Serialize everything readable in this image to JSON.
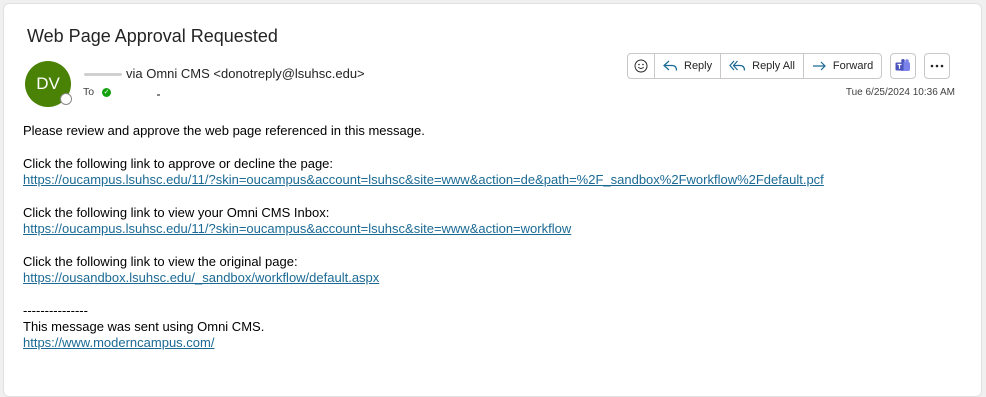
{
  "email": {
    "subject": "Web Page Approval Requested",
    "avatar_initials": "DV",
    "sender": "via Omni CMS <donotreply@lsuhsc.edu>",
    "to_label": "To",
    "date": "Tue 6/25/2024 10:36 AM"
  },
  "actions": {
    "reply": "Reply",
    "reply_all": "Reply All",
    "forward": "Forward"
  },
  "body": {
    "intro": "Please review and approve the web page referenced in this message.",
    "approve_text": "Click the following link to approve or decline the page:",
    "approve_link": "https://oucampus.lsuhsc.edu/11/?skin=oucampus&account=lsuhsc&site=www&action=de&path=%2F_sandbox%2Fworkflow%2Fdefault.pcf",
    "inbox_text": "Click the following link to view your Omni CMS Inbox:",
    "inbox_link": "https://oucampus.lsuhsc.edu/11/?skin=oucampus&account=lsuhsc&site=www&action=workflow",
    "original_text": "Click the following link to view the original page:",
    "original_link": "https://ousandbox.lsuhsc.edu/_sandbox/workflow/default.aspx",
    "separator": "---------------",
    "footer_text": "This message was sent using Omni CMS.",
    "footer_link": "https://www.moderncampus.com/"
  },
  "colors": {
    "avatar": "#498205",
    "link": "#1b6a95",
    "teams": "#4b53bc",
    "reply_icon": "#1b6a95"
  },
  "icons": [
    "smiley-icon",
    "reply-icon",
    "reply-all-icon",
    "forward-icon",
    "teams-icon",
    "more-icon",
    "check-icon"
  ]
}
